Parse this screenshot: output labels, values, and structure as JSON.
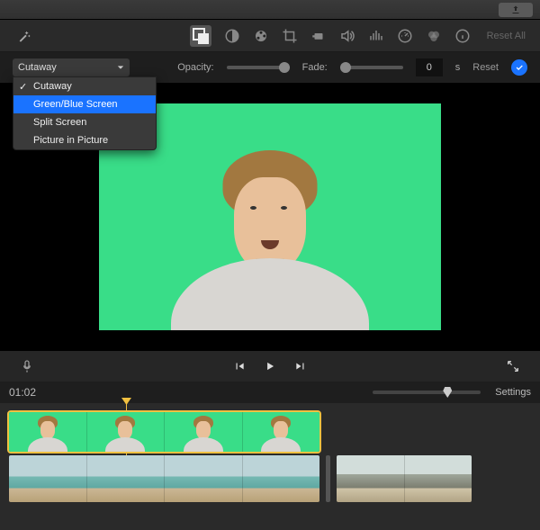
{
  "titlebar": {
    "share_icon": "share-icon"
  },
  "toolbar": {
    "tools": [
      "overlay",
      "filter",
      "color",
      "crop",
      "stabilize",
      "audio",
      "eq",
      "speed",
      "color-balance",
      "info"
    ],
    "reset_all": "Reset All"
  },
  "controls": {
    "dropdown_label": "Cutaway",
    "dropdown_items": [
      "Cutaway",
      "Green/Blue Screen",
      "Split Screen",
      "Picture in Picture"
    ],
    "dropdown_checked_index": 0,
    "dropdown_highlight_index": 1,
    "opacity_label": "Opacity:",
    "fade_label": "Fade:",
    "fade_value": "0",
    "fade_unit": "s",
    "reset_label": "Reset"
  },
  "timebar": {
    "timecode": "01:02",
    "settings": "Settings"
  }
}
